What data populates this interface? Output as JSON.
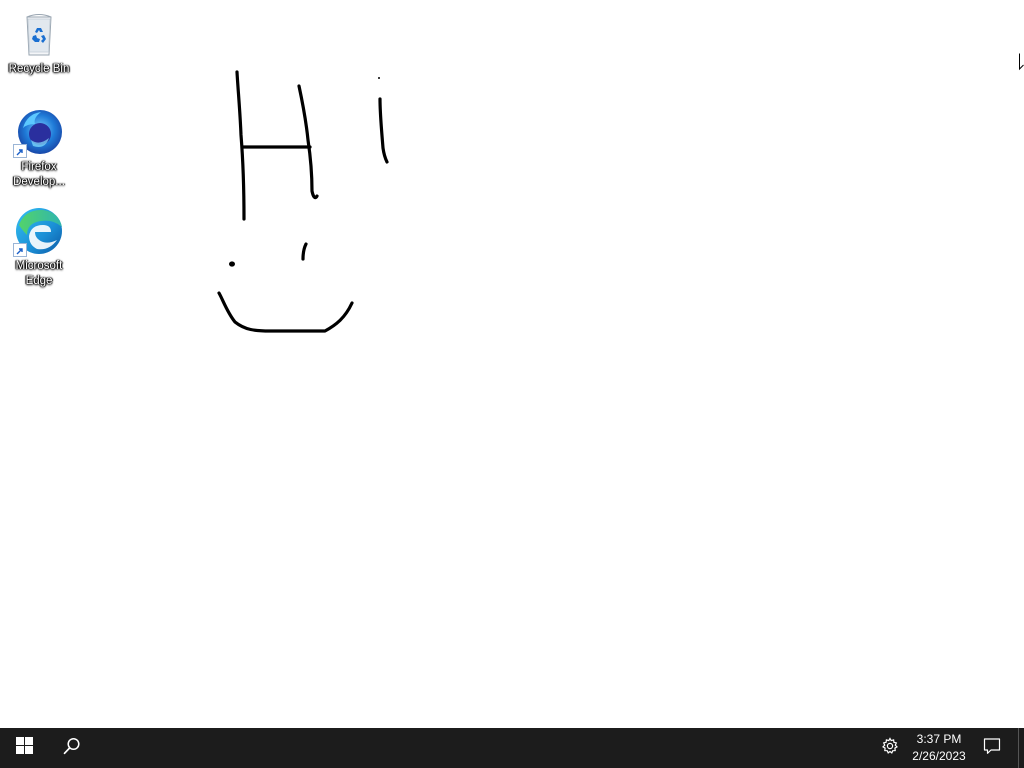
{
  "desktop": {
    "icons": [
      {
        "label": "Recycle Bin",
        "icon": "recycle-bin-icon"
      },
      {
        "label": "Firefox Develop...",
        "icon": "firefox-developer-icon"
      },
      {
        "label": "Microsoft Edge",
        "icon": "edge-icon"
      }
    ],
    "drawing": {
      "description_icon": "freehand-hi-smiley"
    }
  },
  "taskbar": {
    "start_icon": "windows-logo-icon",
    "search_icon": "search-icon",
    "tray_icon": "gear-icon",
    "clock": {
      "time": "3:37 PM",
      "date": "2/26/2023"
    },
    "notification_icon": "notification-icon"
  },
  "colors": {
    "taskbar_bg": "#1c1c1c",
    "desktop_bg": "#ffffff",
    "ink": "#000000"
  }
}
